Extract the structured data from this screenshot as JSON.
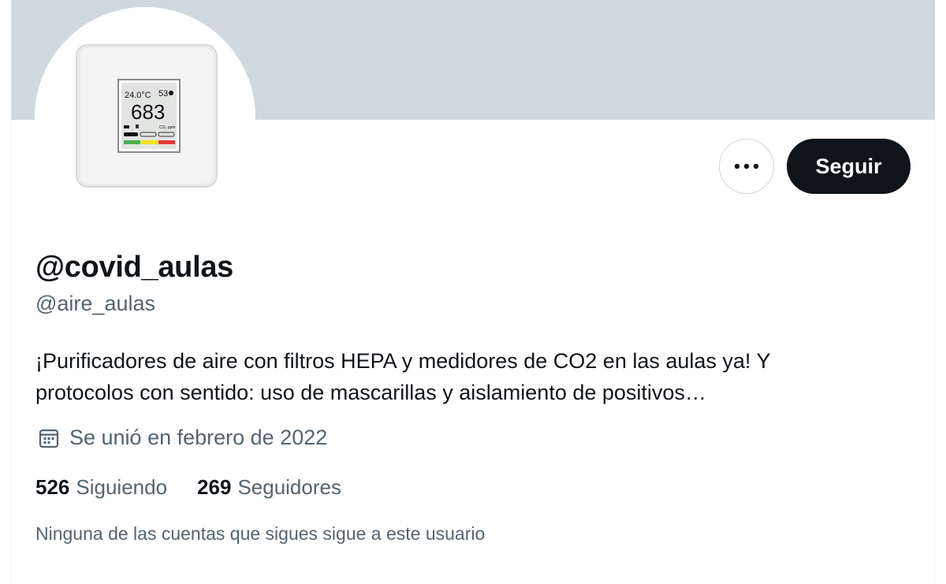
{
  "profile": {
    "display_name": "@covid_aulas",
    "handle": "@aire_aulas",
    "bio_line1": "¡Purificadores de aire con filtros HEPA y medidores de CO2 en las aulas ya! Y",
    "bio_line2": "protocolos con sentido: uso de mascarillas y aislamiento de positivos…",
    "joined": "Se unió en febrero de 2022",
    "joined_icon": "calendar-icon",
    "following_count": "526",
    "following_label": "Siguiendo",
    "followers_count": "269",
    "followers_label": "Seguidores",
    "followers_note": "Ninguna de las cuentas que sigues sigue a este usuario"
  },
  "actions": {
    "follow_label": "Seguir",
    "more_icon": "more-options-icon"
  },
  "avatar_device": {
    "temperature": "24.0°C",
    "humidity": "53",
    "co2_value": "683",
    "co2_unit": "CO₂ ppm"
  },
  "colors": {
    "banner": "#cfd9de",
    "primary_text": "#0f1419",
    "secondary_text": "#536471",
    "follow_button": "#0f1419"
  }
}
